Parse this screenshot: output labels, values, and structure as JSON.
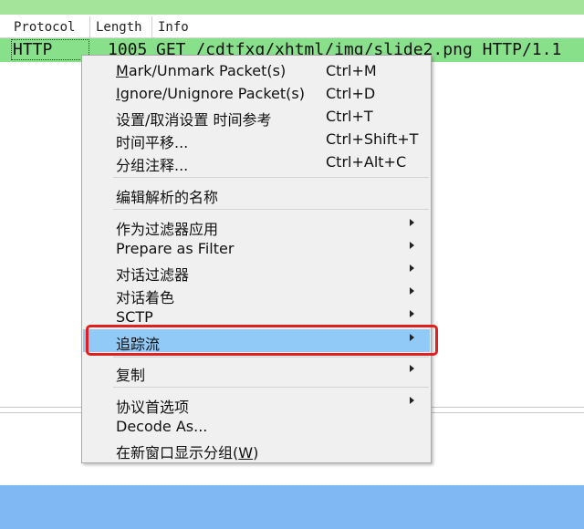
{
  "columns": [
    "Protocol",
    "Length",
    "Info"
  ],
  "packet": {
    "protocol": "HTTP",
    "length": "1005",
    "info": "GET /cdtfxq/xhtml/img/slide2.png HTTP/1.1"
  },
  "menu": {
    "items": [
      {
        "pre": "",
        "ul": "M",
        "post": "ark/Unmark Packet(s)",
        "shortcut": "Ctrl+M"
      },
      {
        "pre": "",
        "ul": "I",
        "post": "gnore/Unignore Packet(s)",
        "shortcut": "Ctrl+D"
      },
      {
        "label": "设置/取消设置 时间参考",
        "shortcut": "Ctrl+T"
      },
      {
        "label": "时间平移...",
        "shortcut": "Ctrl+Shift+T"
      },
      {
        "label": "分组注释...",
        "shortcut": "Ctrl+Alt+C"
      },
      {
        "label": "编辑解析的名称"
      },
      {
        "label": "作为过滤器应用"
      },
      {
        "label": "Prepare as Filter"
      },
      {
        "label": "对话过滤器"
      },
      {
        "label": "对话着色"
      },
      {
        "label": "SCTP"
      },
      {
        "label": "追踪流"
      },
      {
        "label": "复制"
      },
      {
        "label": "协议首选项"
      },
      {
        "label": "Decode As..."
      },
      {
        "pre": "在新窗口显示分组(",
        "ul": "W",
        "post": ")"
      }
    ]
  }
}
